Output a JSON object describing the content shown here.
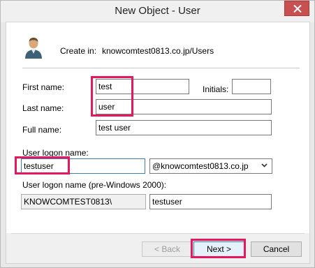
{
  "window": {
    "title": "New Object - User"
  },
  "header": {
    "create_in_label": "Create in:",
    "create_in_value": "knowcomtest0813.co.jp/Users"
  },
  "form": {
    "first_name_label": "First name:",
    "first_name_value": "test",
    "initials_label": "Initials:",
    "initials_value": "",
    "last_name_label": "Last name:",
    "last_name_value": "user",
    "full_name_label": "Full name:",
    "full_name_value": "test user",
    "logon_name_label": "User logon name:",
    "logon_name_value": "testuser",
    "domain_value": "@knowcomtest0813.co.jp",
    "pre2000_label": "User logon name (pre-Windows 2000):",
    "pre2000_domain_value": "KNOWCOMTEST0813\\",
    "pre2000_name_value": "testuser"
  },
  "buttons": {
    "back": "< Back",
    "next": "Next >",
    "cancel": "Cancel"
  },
  "colors": {
    "highlight": "#e5185e",
    "close_button": "#c75050"
  }
}
